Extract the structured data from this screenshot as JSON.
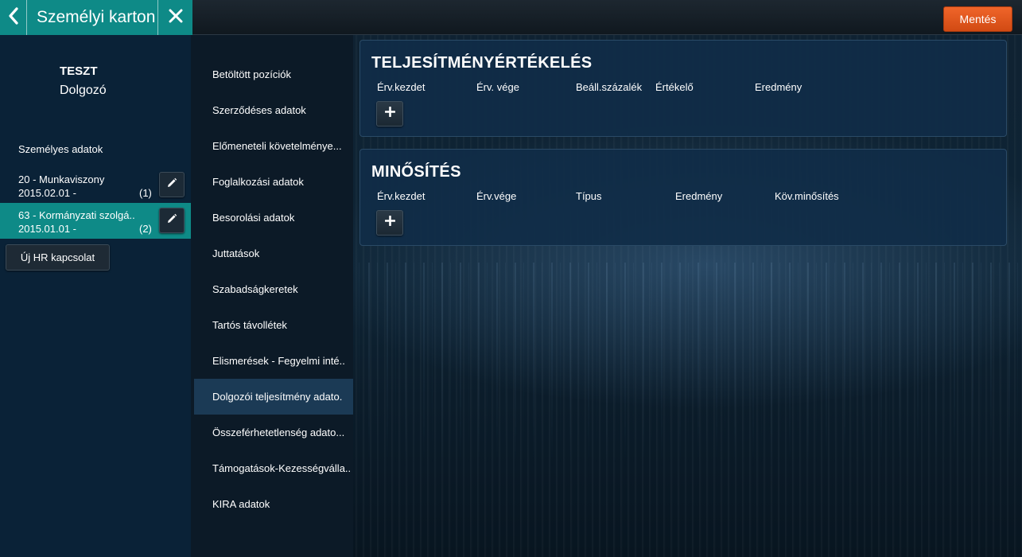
{
  "header": {
    "title": "Személyi karton",
    "save_label": "Mentés"
  },
  "person": {
    "name": "TESZT",
    "role": "Dolgozó"
  },
  "relations": {
    "section_label": "Személyes adatok",
    "items": [
      {
        "line1": "20 - Munkaviszony",
        "line2": "2015.02.01 -",
        "count": "(1)",
        "active": false
      },
      {
        "line1": "63 - Kormányzati szolgá..",
        "line2": "2015.01.01 -",
        "count": "(2)",
        "active": true
      }
    ],
    "new_button_label": "Új HR kapcsolat"
  },
  "nav": {
    "items": [
      "Betöltött pozíciók",
      "Szerződéses adatok",
      "Előmeneteli követelménye...",
      "Foglalkozási adatok",
      "Besorolási adatok",
      "Juttatások",
      "Szabadságkeretek",
      "Tartós távollétek",
      "Elismerések - Fegyelmi inté..",
      "Dolgozói teljesítmény adato.",
      "Összeférhetetlenség adato...",
      "Támogatások-Kezességválla..",
      "KIRA adatok"
    ],
    "active_index": 9
  },
  "cards": [
    {
      "title": "TELJESÍTMÉNYÉRTÉKELÉS",
      "columns": [
        "Érv.kezdet",
        "Érv. vége",
        "Beáll.százalék",
        "Értékelő",
        "Eredmény"
      ]
    },
    {
      "title": "MINŐSÍTÉS",
      "columns": [
        "Érv.kezdet",
        "Érv.vége",
        "Típus",
        "Eredmény",
        "Köv.minősítés"
      ]
    }
  ],
  "colors": {
    "accent_teal": "#0e8a87",
    "save_orange": "#e0541c",
    "card_bg": "#102d48",
    "nav_active": "#1b3a55"
  },
  "icons": {
    "back": "chevron-left-icon",
    "close": "close-icon",
    "edit": "pencil-icon",
    "add": "plus-icon"
  }
}
